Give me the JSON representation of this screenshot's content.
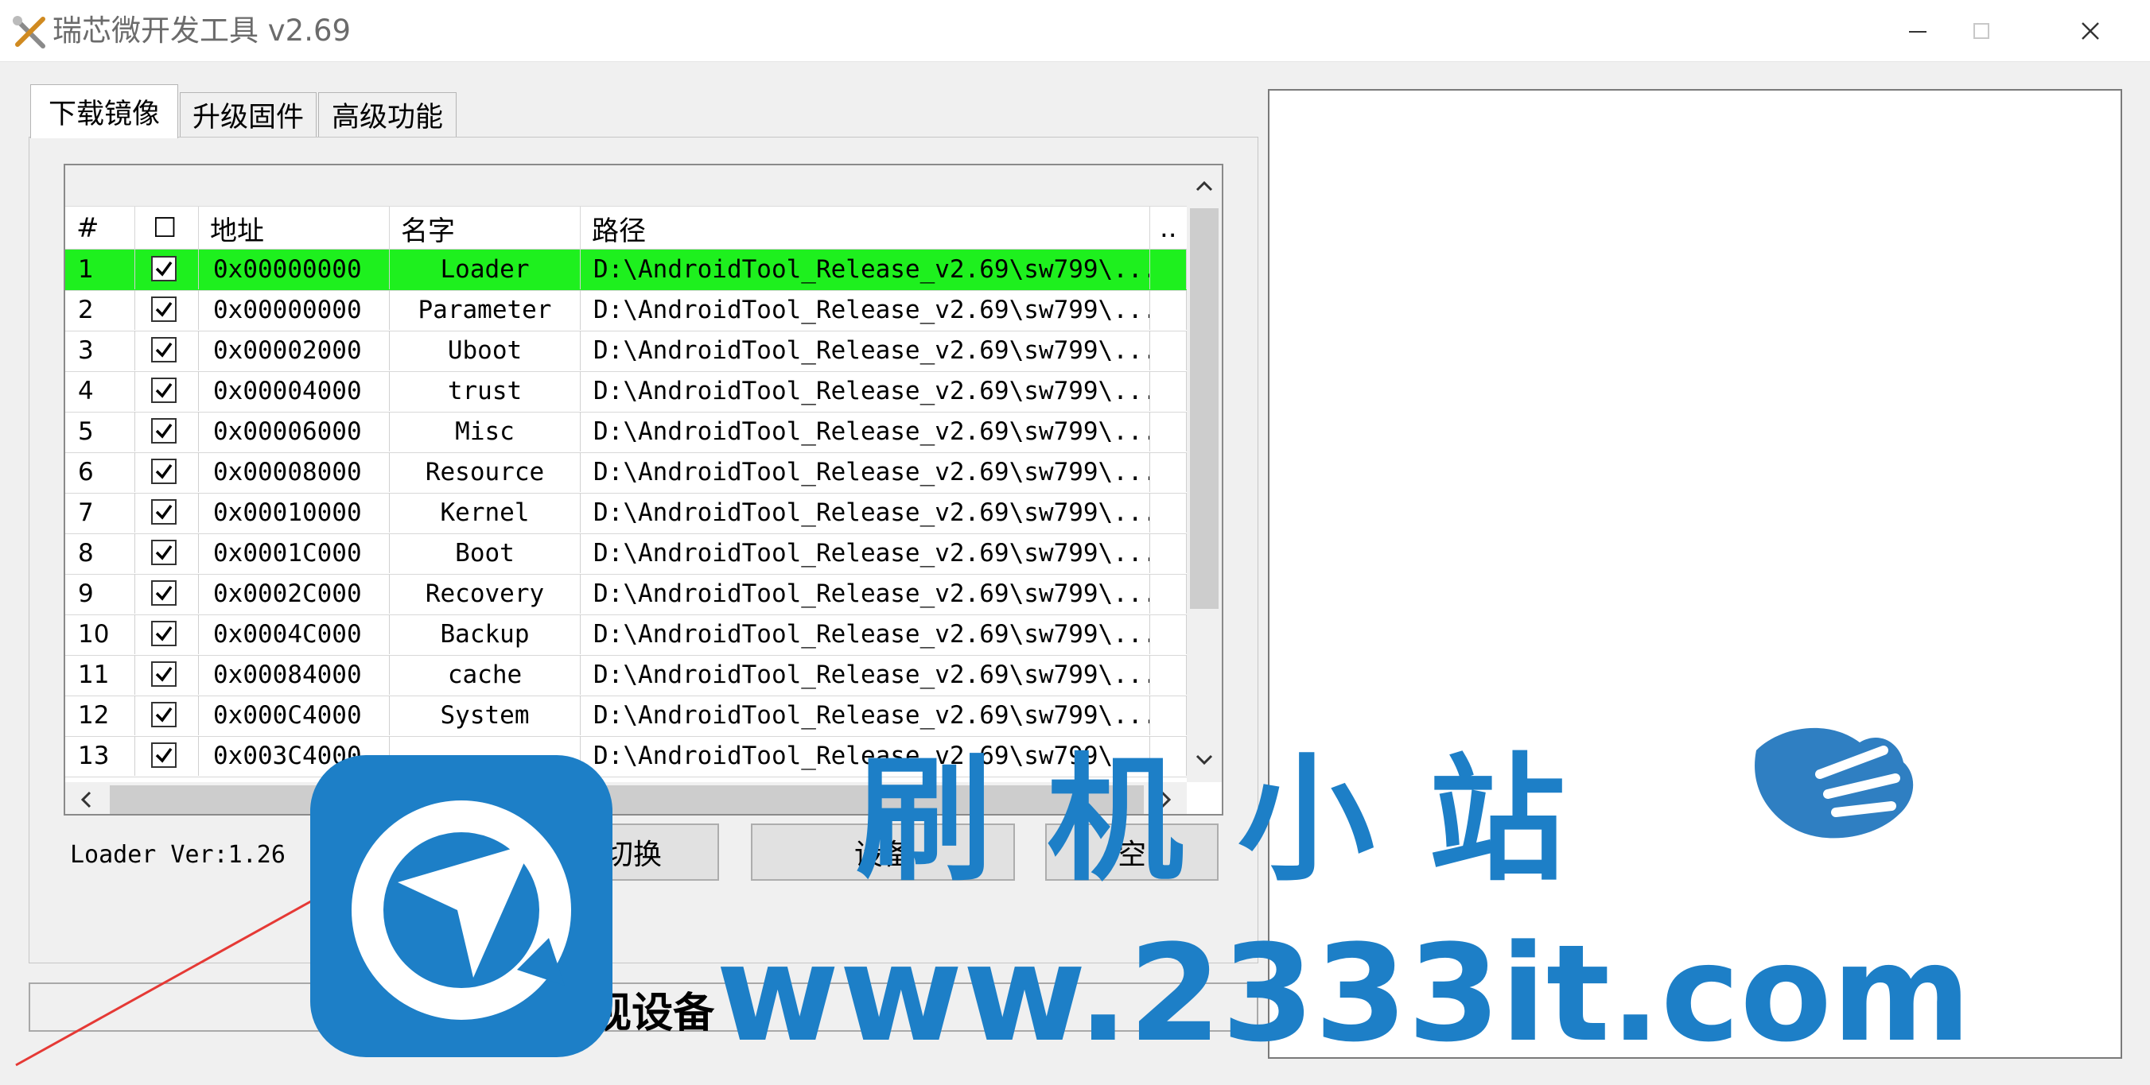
{
  "window": {
    "title": "瑞芯微开发工具 v2.69",
    "controls": [
      "minimize",
      "maximize",
      "close"
    ]
  },
  "tabs": [
    {
      "label": "下载镜像",
      "active": true
    },
    {
      "label": "升级固件",
      "active": false
    },
    {
      "label": "高级功能",
      "active": false
    }
  ],
  "table": {
    "columns": [
      "#",
      "☐",
      "地址",
      "名字",
      "路径",
      ".."
    ],
    "rows": [
      {
        "num": "1",
        "checked": true,
        "addr": "0x00000000",
        "name": "Loader",
        "path": "D:\\AndroidTool_Release_v2.69\\sw799\\...",
        "selected": true
      },
      {
        "num": "2",
        "checked": true,
        "addr": "0x00000000",
        "name": "Parameter",
        "path": "D:\\AndroidTool_Release_v2.69\\sw799\\..."
      },
      {
        "num": "3",
        "checked": true,
        "addr": "0x00002000",
        "name": "Uboot",
        "path": "D:\\AndroidTool_Release_v2.69\\sw799\\..."
      },
      {
        "num": "4",
        "checked": true,
        "addr": "0x00004000",
        "name": "trust",
        "path": "D:\\AndroidTool_Release_v2.69\\sw799\\..."
      },
      {
        "num": "5",
        "checked": true,
        "addr": "0x00006000",
        "name": "Misc",
        "path": "D:\\AndroidTool_Release_v2.69\\sw799\\..."
      },
      {
        "num": "6",
        "checked": true,
        "addr": "0x00008000",
        "name": "Resource",
        "path": "D:\\AndroidTool_Release_v2.69\\sw799\\..."
      },
      {
        "num": "7",
        "checked": true,
        "addr": "0x00010000",
        "name": "Kernel",
        "path": "D:\\AndroidTool_Release_v2.69\\sw799\\..."
      },
      {
        "num": "8",
        "checked": true,
        "addr": "0x0001C000",
        "name": "Boot",
        "path": "D:\\AndroidTool_Release_v2.69\\sw799\\..."
      },
      {
        "num": "9",
        "checked": true,
        "addr": "0x0002C000",
        "name": "Recovery",
        "path": "D:\\AndroidTool_Release_v2.69\\sw799\\..."
      },
      {
        "num": "10",
        "checked": true,
        "addr": "0x0004C000",
        "name": "Backup",
        "path": "D:\\AndroidTool_Release_v2.69\\sw799\\..."
      },
      {
        "num": "11",
        "checked": true,
        "addr": "0x00084000",
        "name": "cache",
        "path": "D:\\AndroidTool_Release_v2.69\\sw799\\..."
      },
      {
        "num": "12",
        "checked": true,
        "addr": "0x000C4000",
        "name": "System",
        "path": "D:\\AndroidTool_Release_v2.69\\sw799\\..."
      },
      {
        "num": "13",
        "checked": true,
        "addr": "0x003C4000",
        "name": "",
        "path": "D:\\AndroidTool_Release_v2.69\\sw799\\..."
      }
    ]
  },
  "loader_version": "Loader Ver:1.26",
  "buttons": {
    "switch": "切换",
    "device_partition": "设备",
    "clear": "空"
  },
  "status": {
    "text": "没 发现设备"
  },
  "watermark": {
    "cn": "刷机小站",
    "url": "www.2333it.com"
  },
  "colors": {
    "selected_row": "#1ef01e",
    "watermark": "#1d7fc7",
    "arrow": "#e53935"
  },
  "icons": [
    "app-tools-icon",
    "minimize-icon",
    "maximize-icon",
    "close-icon",
    "checkbox-checked-icon",
    "scroll-up-icon",
    "scroll-down-icon",
    "scroll-left-icon",
    "scroll-right-icon"
  ]
}
